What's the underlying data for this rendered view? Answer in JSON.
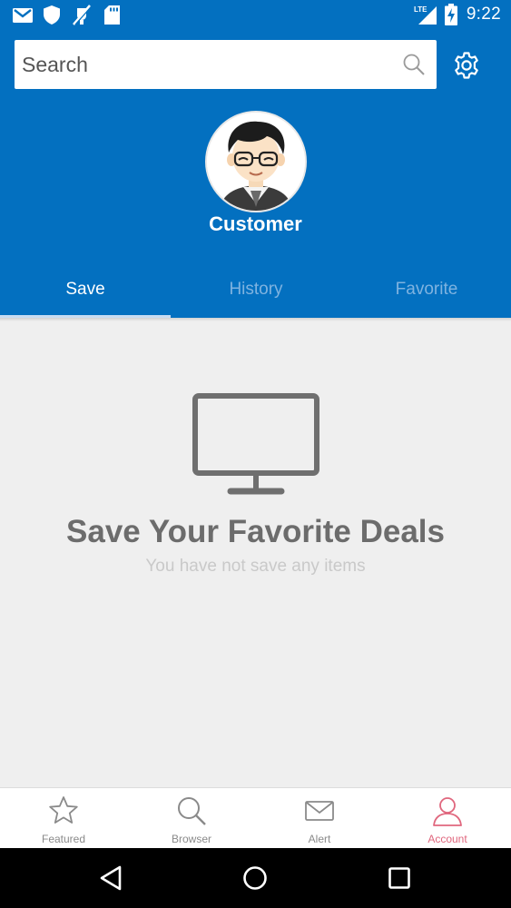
{
  "status_bar": {
    "time": "9:22",
    "network": "LTE",
    "icons": [
      "gmail-icon",
      "shield-icon",
      "no-signal-app-icon",
      "sd-card-icon",
      "lte-signal-icon",
      "battery-charging-icon"
    ]
  },
  "search": {
    "placeholder": "Search"
  },
  "profile": {
    "name": "Customer"
  },
  "tabs": [
    {
      "label": "Save",
      "active": true
    },
    {
      "label": "History",
      "active": false
    },
    {
      "label": "Favorite",
      "active": false
    }
  ],
  "empty_state": {
    "icon": "monitor-icon",
    "title": "Save Your Favorite Deals",
    "subtitle": "You have not save any items"
  },
  "bottom_nav": [
    {
      "label": "Featured",
      "icon": "star-icon",
      "active": false
    },
    {
      "label": "Browser",
      "icon": "search-icon",
      "active": false
    },
    {
      "label": "Alert",
      "icon": "mail-icon",
      "active": false
    },
    {
      "label": "Account",
      "icon": "user-icon",
      "active": true
    }
  ],
  "system_nav": [
    "back-icon",
    "home-icon",
    "recents-icon"
  ],
  "colors": {
    "primary": "#0370c0",
    "accent": "#e0677e",
    "background": "#efefef"
  }
}
